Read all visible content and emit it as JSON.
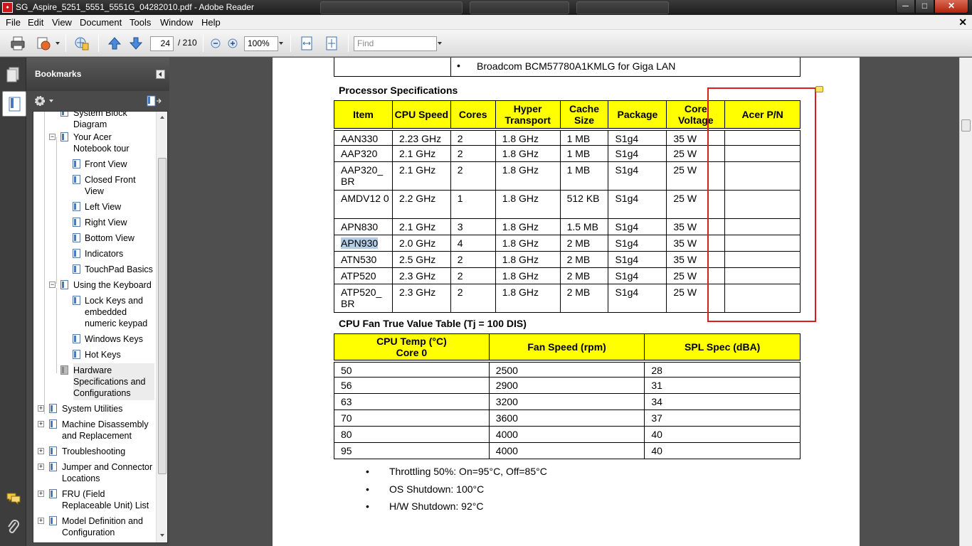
{
  "window": {
    "title": "SG_Aspire_5251_5551_5551G_04282010.pdf - Adobe Reader",
    "controls": {
      "minimize": "─",
      "maximize": "□",
      "close": "✕"
    }
  },
  "menu": {
    "items": [
      "File",
      "Edit",
      "View",
      "Document",
      "Tools",
      "Window",
      "Help"
    ],
    "doc_close": "✕"
  },
  "toolbar": {
    "page_current": "24",
    "page_total": "/ 210",
    "zoom": "100%",
    "find_placeholder": "Find",
    "icons": [
      "print-icon",
      "share-icon",
      "create-pdf-icon",
      "previous-page-icon",
      "next-page-icon",
      "zoom-out-icon",
      "zoom-in-icon",
      "fit-width-icon",
      "fit-page-icon"
    ]
  },
  "sidebar": {
    "bookmarks_title": "Bookmarks",
    "items": [
      {
        "label": "System Block Diagram",
        "level": 2
      },
      {
        "label": "Your Acer Notebook tour",
        "level": 1,
        "expanded": true
      },
      {
        "label": "Front View",
        "level": 2
      },
      {
        "label": "Closed Front View",
        "level": 2
      },
      {
        "label": "Left View",
        "level": 2
      },
      {
        "label": "Right View",
        "level": 2
      },
      {
        "label": "Bottom View",
        "level": 2
      },
      {
        "label": "Indicators",
        "level": 2
      },
      {
        "label": "TouchPad Basics",
        "level": 2
      },
      {
        "label": "Using the Keyboard",
        "level": 1,
        "expanded": true
      },
      {
        "label": "Lock Keys and embedded numeric keypad",
        "level": 2
      },
      {
        "label": "Windows Keys",
        "level": 2
      },
      {
        "label": "Hot Keys",
        "level": 2
      },
      {
        "label": "Hardware Specifications and Configurations",
        "level": 1,
        "selected": true
      },
      {
        "label": "System Utilities",
        "level": 0,
        "expanded": false
      },
      {
        "label": "Machine Disassembly and Replacement",
        "level": 0,
        "expanded": false
      },
      {
        "label": "Troubleshooting",
        "level": 0,
        "expanded": false
      },
      {
        "label": "Jumper and Connector Locations",
        "level": 0,
        "expanded": false
      },
      {
        "label": "FRU (Field Replaceable Unit) List",
        "level": 0,
        "expanded": false
      },
      {
        "label": "Model Definition and Configuration",
        "level": 0,
        "expanded": false
      }
    ]
  },
  "document": {
    "top_row_text": "Broadcom BCM57780A1KMLG for Giga LAN",
    "processor_section_title": "Processor Specifications",
    "processor_headers": [
      "Item",
      "CPU Speed",
      "Cores",
      "Hyper Transport",
      "Cache Size",
      "Package",
      "Core Voltage",
      "Acer P/N"
    ],
    "processor_rows": [
      {
        "item": "AAN330",
        "speed": "2.23 GHz",
        "cores": "2",
        "ht": "1.8 GHz",
        "cache": "1 MB",
        "package": "S1g4",
        "voltage": "35 W",
        "pn": ""
      },
      {
        "item": "AAP320",
        "speed": "2.1 GHz",
        "cores": "2",
        "ht": "1.8 GHz",
        "cache": "1 MB",
        "package": "S1g4",
        "voltage": "25 W",
        "pn": ""
      },
      {
        "item": "AAP320_ BR",
        "speed": "2.1 GHz",
        "cores": "2",
        "ht": "1.8 GHz",
        "cache": "1 MB",
        "package": "S1g4",
        "voltage": "25 W",
        "pn": ""
      },
      {
        "item": "AMDV12 0",
        "speed": "2.2 GHz",
        "cores": "1",
        "ht": "1.8 GHz",
        "cache": "512 KB",
        "package": "S1g4",
        "voltage": "25 W",
        "pn": ""
      },
      {
        "item": "APN830",
        "speed": "2.1 GHz",
        "cores": "3",
        "ht": "1.8 GHz",
        "cache": "1.5 MB",
        "package": "S1g4",
        "voltage": "35 W",
        "pn": ""
      },
      {
        "item": "APN930",
        "speed": "2.0 GHz",
        "cores": "4",
        "ht": "1.8 GHz",
        "cache": "2 MB",
        "package": "S1g4",
        "voltage": "35 W",
        "pn": "",
        "highlighted": true
      },
      {
        "item": "ATN530",
        "speed": "2.5 GHz",
        "cores": "2",
        "ht": "1.8 GHz",
        "cache": "2 MB",
        "package": "S1g4",
        "voltage": "35 W",
        "pn": ""
      },
      {
        "item": "ATP520",
        "speed": "2.3 GHz",
        "cores": "2",
        "ht": "1.8 GHz",
        "cache": "2 MB",
        "package": "S1g4",
        "voltage": "25 W",
        "pn": ""
      },
      {
        "item": "ATP520_ BR",
        "speed": "2.3 GHz",
        "cores": "2",
        "ht": "1.8 GHz",
        "cache": "2 MB",
        "package": "S1g4",
        "voltage": "25 W",
        "pn": ""
      }
    ],
    "fan_section_title": "CPU Fan True Value Table (Tj = 100 DIS)",
    "fan_headers": [
      "CPU Temp (°C) Core 0",
      "Fan Speed (rpm)",
      "SPL Spec (dBA)"
    ],
    "fan_rows": [
      [
        "50",
        "2500",
        "28"
      ],
      [
        "56",
        "2900",
        "31"
      ],
      [
        "63",
        "3200",
        "34"
      ],
      [
        "70",
        "3600",
        "37"
      ],
      [
        "80",
        "4000",
        "40"
      ],
      [
        "95",
        "4000",
        "40"
      ]
    ],
    "notes": [
      "Throttling 50%: On=95°C, Off=85°C",
      "OS Shutdown: 100°C",
      "H/W Shutdown: 92°C"
    ],
    "bullet": "•",
    "annotation_color": "#dd1c1c",
    "header_color": "#ffff00"
  }
}
